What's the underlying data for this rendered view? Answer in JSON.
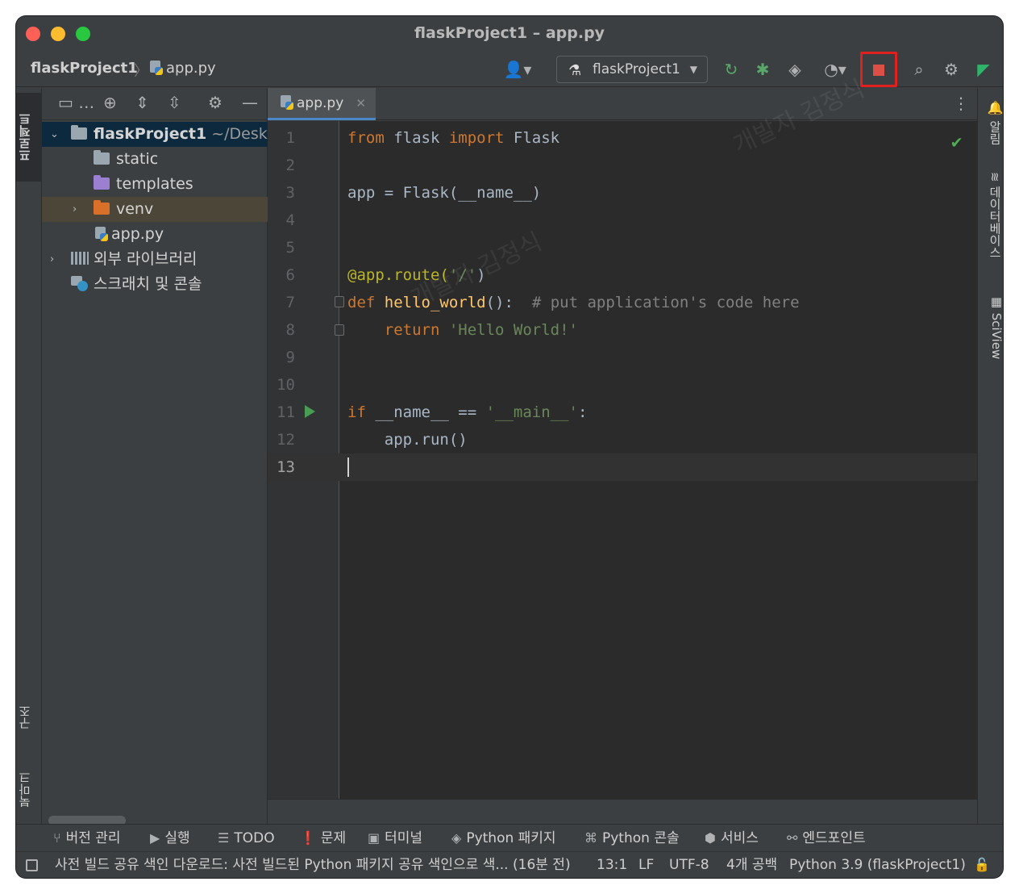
{
  "window": {
    "title": "flaskProject1 – app.py"
  },
  "navbar": {
    "project": "flaskProject1",
    "file": "app.py",
    "run_config": "flaskProject1",
    "icons": [
      "user-icon",
      "rerun-icon",
      "debug-icon",
      "coverage-icon",
      "profile-icon",
      "stop-icon",
      "search-icon",
      "settings-icon",
      "code-with-me-icon"
    ]
  },
  "left_strip": {
    "project_tab": "프로젝트",
    "structure_tab": "구조",
    "bookmarks_tab": "북마크"
  },
  "project_tree": {
    "root_name": "flaskProject1",
    "root_path": "~/Desktop",
    "items": [
      {
        "label": "static"
      },
      {
        "label": "templates"
      },
      {
        "label": "venv"
      },
      {
        "label": "app.py"
      }
    ],
    "external_libraries": "외부 라이브러리",
    "scratches": "스크래치 및 콘솔"
  },
  "editor": {
    "tab": "app.py",
    "lines": [
      {
        "n": "1"
      },
      {
        "n": "2"
      },
      {
        "n": "3"
      },
      {
        "n": "4"
      },
      {
        "n": "5"
      },
      {
        "n": "6"
      },
      {
        "n": "7"
      },
      {
        "n": "8"
      },
      {
        "n": "9"
      },
      {
        "n": "10"
      },
      {
        "n": "11"
      },
      {
        "n": "12"
      },
      {
        "n": "13"
      }
    ],
    "code": {
      "l1_from": "from",
      "l1_mod": " flask ",
      "l1_import": "import",
      "l1_name": " Flask",
      "l3": "app = Flask(__name__)",
      "l6_deco": "@app.route(",
      "l6_str": "'/'",
      "l6_end": ")",
      "l7_def": "def",
      "l7_fn": " hello_world",
      "l7_args": "():  ",
      "l7_cmt": "# put application's code here",
      "l8_ret": "    return",
      "l8_str": " 'Hello World!'",
      "l11_if": "if",
      "l11_mid": " __name__ == ",
      "l11_str": "'__main__'",
      "l11_end": ":",
      "l12": "    app.run()"
    }
  },
  "right_strip": {
    "notifications": "알림",
    "database": "데이터베이스",
    "sciview": "SciView"
  },
  "tool_windows": [
    {
      "label": "버전 관리"
    },
    {
      "label": "실행"
    },
    {
      "label": "TODO"
    },
    {
      "label": "문제"
    },
    {
      "label": "터미널"
    },
    {
      "label": "Python 패키지"
    },
    {
      "label": "Python 콘솔"
    },
    {
      "label": "서비스"
    },
    {
      "label": "엔드포인트"
    }
  ],
  "status": {
    "message": "사전 빌드 공유 색인 다운로드: 사전 빌드된 Python 패키지 공유 색인으로 색... (16분 전)",
    "position": "13:1",
    "line_sep": "LF",
    "encoding": "UTF-8",
    "indent": "4개 공백",
    "interpreter": "Python 3.9 (flaskProject1)"
  },
  "watermark": "개발자 김정식",
  "colors": {
    "accent": "#4a88c7",
    "stop_highlight": "#e0201e",
    "run_green": "#499c54"
  }
}
